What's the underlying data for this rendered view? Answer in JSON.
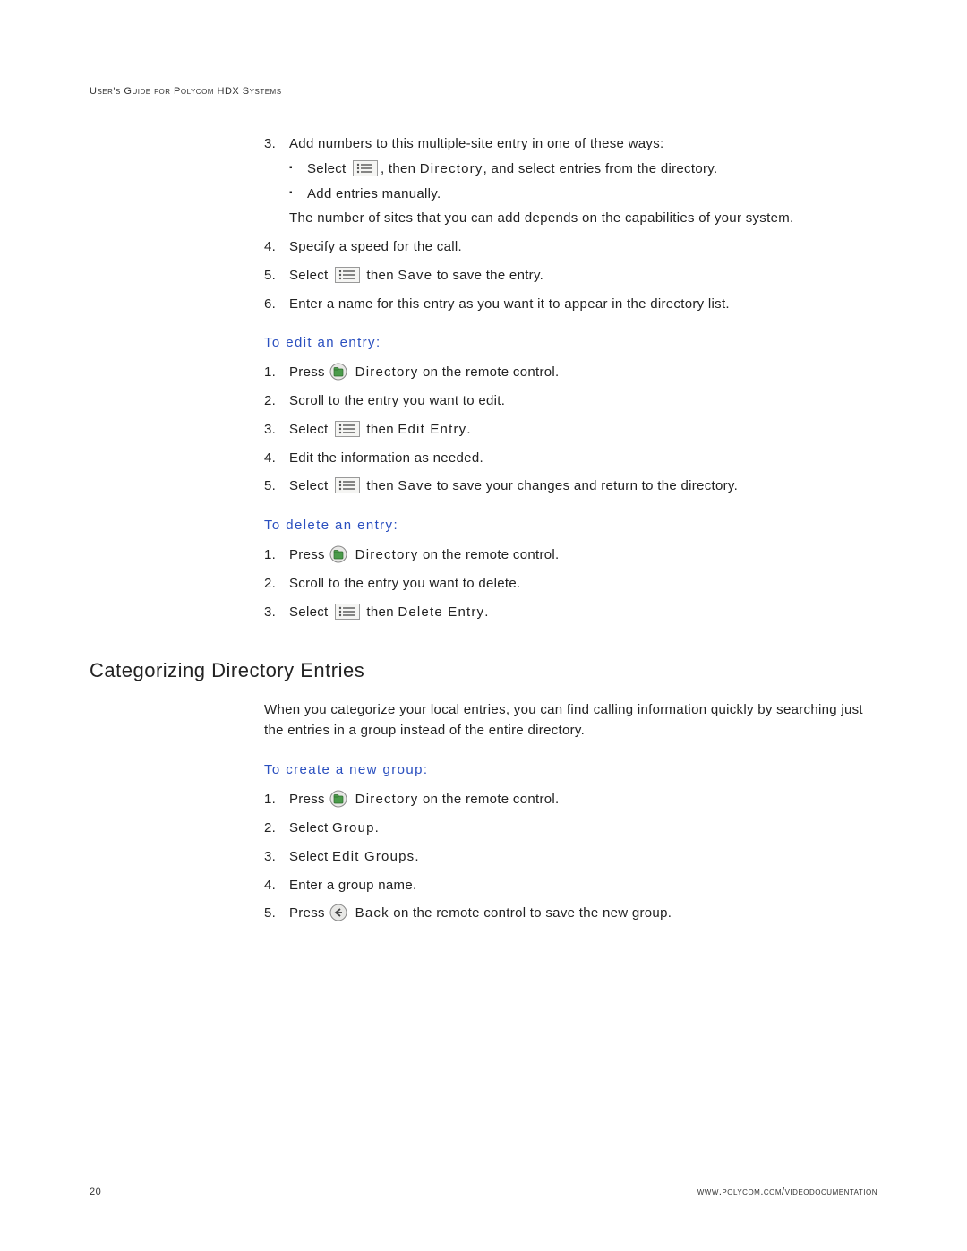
{
  "header": "User's Guide for Polycom HDX Systems",
  "list1": {
    "i3": {
      "num": "3.",
      "lead": "Add numbers to this multiple-site entry in one of these ways:",
      "sub1_a": "Select ",
      "sub1_b": ", then ",
      "sub1_c": "Directory",
      "sub1_d": ", and select entries from the directory.",
      "sub2": "Add entries manually.",
      "note": "The number of sites that you can add depends on the capabilities of your system."
    },
    "i4": {
      "num": "4.",
      "txt": "Specify a speed for the call."
    },
    "i5": {
      "num": "5.",
      "a": "Select ",
      "b": " then ",
      "c": "Save",
      "d": " to save the entry."
    },
    "i6": {
      "num": "6.",
      "txt": "Enter a name for this entry as you want it to appear in the directory list."
    }
  },
  "edit": {
    "head": "To edit an entry:",
    "i1": {
      "num": "1.",
      "a": "Press ",
      "b": " Directory",
      "c": " on the remote control."
    },
    "i2": {
      "num": "2.",
      "txt": "Scroll to the entry you want to edit."
    },
    "i3": {
      "num": "3.",
      "a": "Select ",
      "b": " then ",
      "c": "Edit Entry",
      "d": "."
    },
    "i4": {
      "num": "4.",
      "txt": "Edit the information as needed."
    },
    "i5": {
      "num": "5.",
      "a": "Select ",
      "b": " then ",
      "c": "Save",
      "d": " to save your changes and return to the directory."
    }
  },
  "del": {
    "head": "To delete an entry:",
    "i1": {
      "num": "1.",
      "a": "Press ",
      "b": " Directory",
      "c": " on the remote control."
    },
    "i2": {
      "num": "2.",
      "txt": "Scroll to the entry you want to delete."
    },
    "i3": {
      "num": "3.",
      "a": "Select ",
      "b": " then ",
      "c": "Delete Entry",
      "d": "."
    }
  },
  "section": {
    "head": "Categorizing Directory Entries",
    "para": "When you categorize your local entries, you can find calling information quickly by searching just the entries in a group instead of the entire directory."
  },
  "grp": {
    "head": "To create a new group:",
    "i1": {
      "num": "1.",
      "a": "Press ",
      "b": " Directory",
      "c": " on the remote control."
    },
    "i2": {
      "num": "2.",
      "a": "Select ",
      "b": "Group",
      "c": "."
    },
    "i3": {
      "num": "3.",
      "a": "Select ",
      "b": "Edit Groups",
      "c": "."
    },
    "i4": {
      "num": "4.",
      "txt": "Enter a group name."
    },
    "i5": {
      "num": "5.",
      "a": "Press ",
      "b": " Back",
      "c": " on the remote control to save the new group."
    }
  },
  "footer": {
    "page": "20",
    "url": "www.polycom.com/videodocumentation"
  }
}
